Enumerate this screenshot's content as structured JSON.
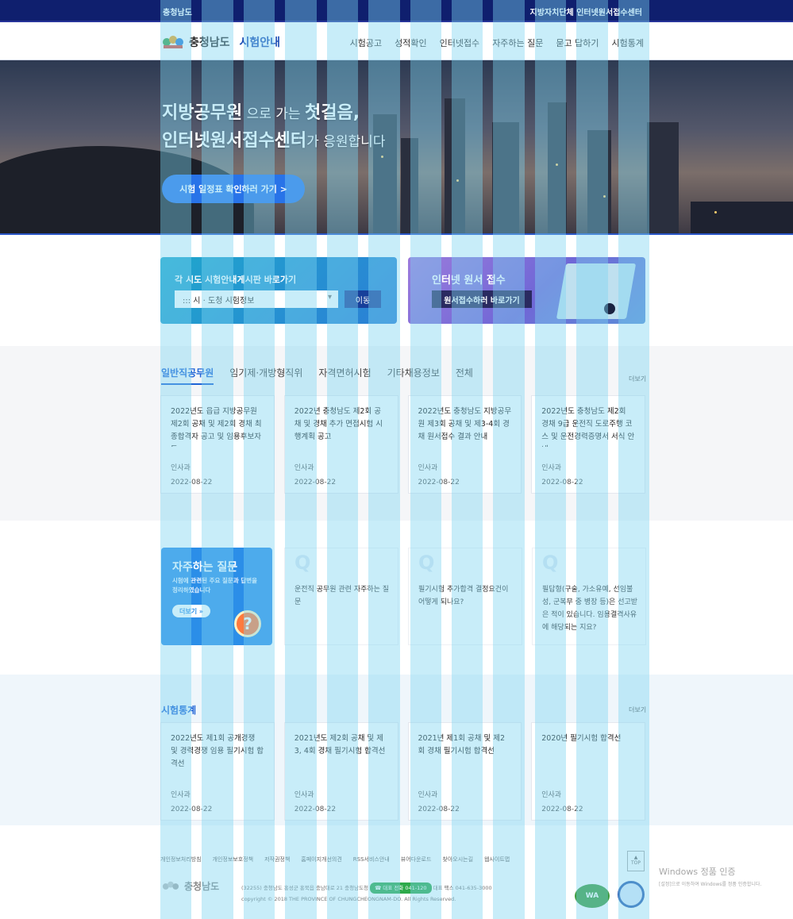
{
  "top_bar": {
    "left": "충청남도",
    "right": "지방자치단체 인터넷원서접수센터"
  },
  "header": {
    "logo_name": "충청남도",
    "logo_sub": "시험안내",
    "nav": [
      "시험공고",
      "성적확인",
      "인터넷접수",
      "자주하는 질문",
      "묻고 답하기",
      "시험통계"
    ]
  },
  "hero": {
    "line1_strong": "지방공무원",
    "line1_thin": " 으로 가는 ",
    "line1_end": "첫걸음,",
    "line2_strong": "인터넷원서접수센터",
    "line2_thin": "가 응원합니다",
    "cta": "시험 일정표 확인하러 가기 >"
  },
  "quick_sido": {
    "title": "각 시도 시험안내게시판 바로가기",
    "select": "::: 시 · 도청 시험정보",
    "go": "이동"
  },
  "quick_net": {
    "title": "인터넷 원서 접수",
    "button": "원서접수하러 바로가기"
  },
  "notice": {
    "tabs": [
      "일반직공무원",
      "임기제·개방형직위",
      "자격면허시험",
      "기타채용정보",
      "전체"
    ],
    "more": "더보기",
    "cards": [
      {
        "title": "2022년도 읍급 지방공무원 제2회 공채 및 제2회 경채 최종합격자 공고 및 임용후보자 등 ...",
        "dept": "인사과",
        "date": "2022-08-22"
      },
      {
        "title": "2022년 충청남도 제2회 공채 및 경채 추가 면접시험 시행계획 공고",
        "dept": "인사과",
        "date": "2022-08-22"
      },
      {
        "title": "2022년도 충청남도 지방공무원 제3회 공채 및 제3-4회 경채 원서접수 결과 안내",
        "dept": "인사과",
        "date": "2022-08-22"
      },
      {
        "title": "2022년도 충청남도 제2회 경채 9급 운전직 도로주행 코스 및 운전경력증명서 서식 안내",
        "dept": "인사과",
        "date": "2022-08-22"
      }
    ]
  },
  "faq": {
    "title": "자주하는 질문",
    "desc": "시험에 관련된 주요 질문과 답변을 정리하였습니다",
    "more": "더보기 »",
    "q_mark": "Q",
    "items": [
      "운전직 공무원 관련 자주하는 질문",
      "필기시험 추가합격 결정요건이 어떻게 되나요?",
      "필답형(구술, 가소유예, 선임불성, 군복무 중 병장 등)은 선고받은 적이 있습니다. 임용결격사유에 해당되는 지요?"
    ]
  },
  "stats": {
    "title": "시험통계",
    "more": "더보기",
    "cards": [
      {
        "title": "2022년도 제1회 공개경쟁 및 경력경쟁 임용 필기시험 합격선",
        "dept": "인사과",
        "date": "2022-08-22"
      },
      {
        "title": "2021년도 제2회 공채 및 제3, 4회 경채 필기시험 합격선",
        "dept": "인사과",
        "date": "2022-08-22"
      },
      {
        "title": "2021년 제1회 공채 및 제2회 경채 필기시험 합격선",
        "dept": "인사과",
        "date": "2022-08-22"
      },
      {
        "title": "2020년 필기시험 합격선",
        "dept": "인사과",
        "date": "2022-08-22"
      }
    ]
  },
  "footer": {
    "links": [
      "개인정보처리방침",
      "개인정보보호정책",
      "저작권정책",
      "홈페이지개선의견",
      "RSS서비스안내",
      "뷰어다운로드",
      "찾아오시는길",
      "웹사이트맵"
    ],
    "logo": "충청남도",
    "addr": "(32255) 충청남도 홍성군 홍북읍 충남대로 21 충청남도청",
    "call": "☎ 대표 전화 041-120",
    "fax": "대표 팩스 041-635-3000",
    "copyright": "copyright © 2018 THE PROVINCE OF CHUNGCHEONGNAM-DO. All Rights Reserved.",
    "top": "TOP",
    "badge1": "WA",
    "win_line1": "Windows 정품 인증",
    "win_line2": "[설정]으로 이동하여 Windows를 정품 인증합니다."
  },
  "colors": {
    "navy": "#0f1f6e",
    "accent": "#1e63d6",
    "faq_blue": "#2b8ee8",
    "overlay": "#7dd4f0"
  }
}
